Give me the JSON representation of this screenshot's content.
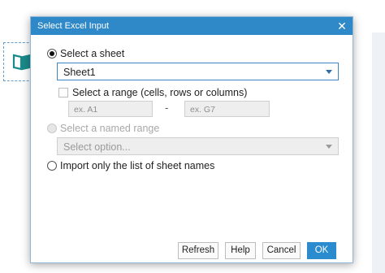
{
  "dialog": {
    "title": "Select Excel Input",
    "close_glyph": "✕"
  },
  "options": {
    "sheet_label": "Select a sheet",
    "sheet_selected": "Sheet1",
    "range_label": "Select a range (cells, rows or columns)",
    "range_from_placeholder": "ex. A1",
    "range_to_placeholder": "ex. G7",
    "range_separator": "-",
    "named_range_label": "Select a named range",
    "named_range_placeholder": "Select option...",
    "import_names_label": "Import only the list of sheet names"
  },
  "buttons": {
    "refresh": "Refresh",
    "help": "Help",
    "cancel": "Cancel",
    "ok": "OK"
  },
  "colors": {
    "accent": "#2f88c7",
    "primary_button": "#2a8ccf",
    "icon": "#1a8a8a"
  }
}
